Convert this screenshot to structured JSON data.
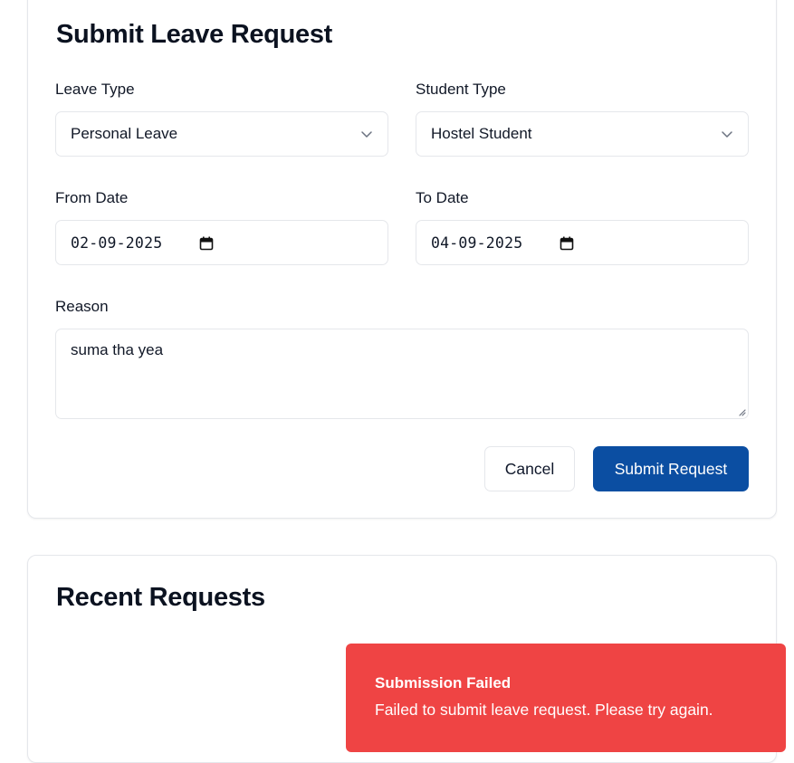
{
  "form": {
    "title": "Submit Leave Request",
    "leave_type": {
      "label": "Leave Type",
      "value": "Personal Leave"
    },
    "student_type": {
      "label": "Student Type",
      "value": "Hostel Student"
    },
    "from_date": {
      "label": "From Date",
      "value": "02-09-2025"
    },
    "to_date": {
      "label": "To Date",
      "value": "04-09-2025"
    },
    "reason": {
      "label": "Reason",
      "value": "suma tha yea"
    },
    "cancel_label": "Cancel",
    "submit_label": "Submit Request"
  },
  "recent": {
    "title": "Recent Requests"
  },
  "toast": {
    "title": "Submission Failed",
    "message": "Failed to submit leave request. Please try again."
  },
  "colors": {
    "primary": "#0b4ea2",
    "error": "#ef4444",
    "border": "#e5e7eb"
  },
  "icons": {
    "select": "chevron-down-icon",
    "date": "calendar-icon"
  }
}
